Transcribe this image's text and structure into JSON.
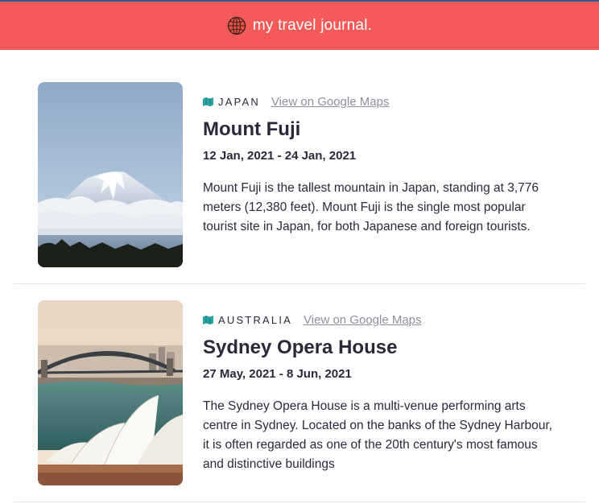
{
  "header": {
    "title": "my travel journal."
  },
  "entries": [
    {
      "country": "JAPAN",
      "maps_link": "View on Google Maps",
      "title": "Mount Fuji",
      "dates": "12 Jan, 2021 - 24 Jan, 2021",
      "description": "Mount Fuji is the tallest mountain in Japan, standing at 3,776 meters (12,380 feet). Mount Fuji is the single most popular tourist site in Japan, for both Japanese and foreign tourists."
    },
    {
      "country": "AUSTRALIA",
      "maps_link": "View on Google Maps",
      "title": "Sydney Opera House",
      "dates": "27 May, 2021 - 8 Jun, 2021",
      "description": "The Sydney Opera House is a multi-venue performing arts centre in Sydney. Located on the banks of the Sydney Harbour, it is often regarded as one of the 20th century's most famous and distinctive buildings"
    }
  ],
  "icons": {
    "header": "globe-icon",
    "location": "map-icon"
  },
  "colors": {
    "header_bg": "#f55a5a",
    "text": "#2b283a",
    "link": "#918e9b",
    "map_icon": "#2ba4a4"
  }
}
